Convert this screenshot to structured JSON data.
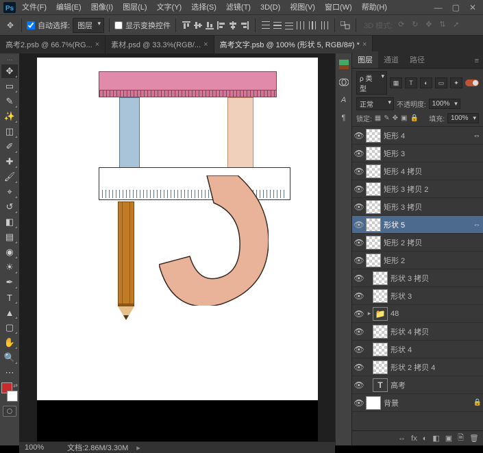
{
  "window": {
    "min": "—",
    "max": "▢",
    "close": "✕"
  },
  "menubar": {
    "items": [
      "文件(F)",
      "编辑(E)",
      "图像(I)",
      "图层(L)",
      "文字(Y)",
      "选择(S)",
      "滤镜(T)",
      "3D(D)",
      "视图(V)",
      "窗口(W)",
      "帮助(H)"
    ]
  },
  "optionsbar": {
    "auto_select_label": "自动选择:",
    "auto_select_target": "图层",
    "transform_controls_label": "显示变换控件",
    "mode3d_label": "3D 模式:"
  },
  "tabs": [
    {
      "label": "高考2.psb @ 66.7%(RG...",
      "active": false
    },
    {
      "label": "素材.psd @ 33.3%(RGB/...",
      "active": false
    },
    {
      "label": "高考文字.psb @ 100% (形状 5, RGB/8#) *",
      "active": true
    }
  ],
  "status": {
    "zoom": "100%",
    "docinfo": "文档:2.86M/3.30M"
  },
  "rightcol": {
    "icons": [
      "color-swatch-icon",
      "histogram-icon",
      "character-icon",
      "swatches-panel-icon"
    ]
  },
  "panels": {
    "tabs": [
      "图层",
      "通道",
      "路径"
    ],
    "active_tab": 0,
    "filter": {
      "kind_label": "ρ 类型",
      "icons": [
        "▦",
        "T",
        "◐",
        "▭",
        "✦"
      ]
    },
    "blend": {
      "mode": "正常",
      "opacity_label": "不透明度:",
      "opacity_value": "100%"
    },
    "lock": {
      "label": "锁定:",
      "fill_label": "填充:",
      "fill_value": "100%"
    },
    "footer_icons": [
      "⇔",
      "fx",
      "◐",
      "◧",
      "▣",
      "🗎",
      "🗑"
    ]
  },
  "layers": [
    {
      "name": "矩形 4",
      "visible": true,
      "linked": true,
      "thumb": "checker"
    },
    {
      "name": "矩形 3",
      "visible": true,
      "thumb": "checker"
    },
    {
      "name": "矩形 4 拷贝",
      "visible": true,
      "thumb": "checker"
    },
    {
      "name": "矩形 3 拷贝 2",
      "visible": true,
      "thumb": "checker"
    },
    {
      "name": "矩形 3 拷贝",
      "visible": true,
      "thumb": "checker"
    },
    {
      "name": "形状 5",
      "visible": true,
      "selected": true,
      "linked": true,
      "thumb": "checker"
    },
    {
      "name": "矩形 2 拷贝",
      "visible": true,
      "thumb": "checker"
    },
    {
      "name": "矩形 2",
      "visible": true,
      "thumb": "checker"
    },
    {
      "name": "形状 3 拷贝",
      "visible": true,
      "indent": 1,
      "thumb": "checker"
    },
    {
      "name": "形状 3",
      "visible": true,
      "indent": 1,
      "thumb": "checker"
    },
    {
      "name": "48",
      "visible": true,
      "group": true,
      "expandable": true
    },
    {
      "name": "形状 4 拷贝",
      "visible": true,
      "indent": 1,
      "thumb": "checker"
    },
    {
      "name": "形状 4",
      "visible": true,
      "indent": 1,
      "thumb": "checker"
    },
    {
      "name": "形状 2 拷贝 4",
      "visible": true,
      "indent": 1,
      "thumb": "checker"
    },
    {
      "name": "高考",
      "visible": true,
      "indent": 1,
      "thumb": "text"
    },
    {
      "name": "背景",
      "visible": true,
      "locked": true,
      "thumb": "solid"
    }
  ]
}
